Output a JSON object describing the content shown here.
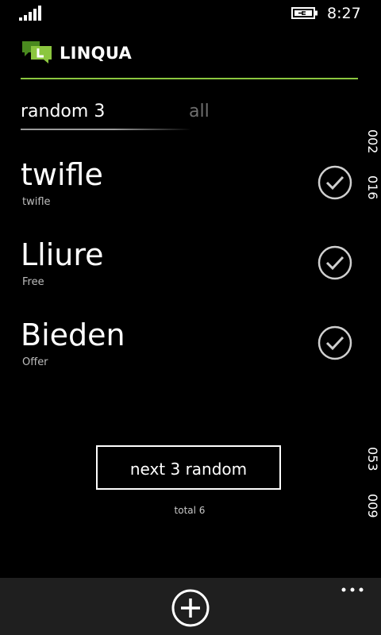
{
  "status_bar": {
    "time": "8:27",
    "signal_icon": "signal-bars-icon",
    "battery_icon": "battery-charging-icon"
  },
  "app": {
    "title": "LINQUA",
    "logo_icon": "linqua-logo-icon",
    "accent_color": "#8bc63f"
  },
  "pivot": {
    "tabs": [
      {
        "label": "random 3",
        "active": true
      },
      {
        "label": "all",
        "active": false
      }
    ]
  },
  "words": [
    {
      "term": "twifle",
      "translation": "twifle",
      "checked": true
    },
    {
      "term": "Lliure",
      "translation": "Free",
      "checked": true
    },
    {
      "term": "Bieden",
      "translation": "Offer",
      "checked": true
    }
  ],
  "actions": {
    "next_label": "next 3 random",
    "total_label": "total 6"
  },
  "side_numbers": [
    "002",
    "016",
    "053",
    "009"
  ],
  "app_bar": {
    "add_icon": "add-circle-icon",
    "more_icon": "more-dots-icon"
  }
}
